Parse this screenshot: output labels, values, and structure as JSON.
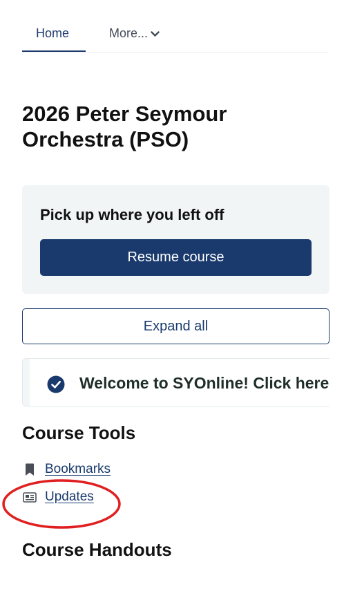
{
  "nav": {
    "tabs": [
      {
        "label": "Home",
        "active": true
      },
      {
        "label": "More...",
        "icon": "chevron-down-icon"
      }
    ]
  },
  "course": {
    "title": "2026 Peter Seymour Orchestra (PSO)"
  },
  "resume": {
    "heading": "Pick up where you left off",
    "button_label": "Resume course"
  },
  "outline": {
    "expand_label": "Expand all",
    "sections": [
      {
        "title": "Welcome to SYOnline! Click here",
        "icon": "check-circle-icon",
        "complete": true
      }
    ]
  },
  "tools": {
    "heading": "Course Tools",
    "items": [
      {
        "label": "Bookmarks",
        "icon": "bookmark-icon"
      },
      {
        "label": "Updates",
        "icon": "newspaper-icon"
      }
    ]
  },
  "handouts": {
    "heading": "Course Handouts"
  },
  "colors": {
    "primary": "#1a3a6d",
    "annotation": "#e02020",
    "card_bg": "#f2f5f5"
  }
}
